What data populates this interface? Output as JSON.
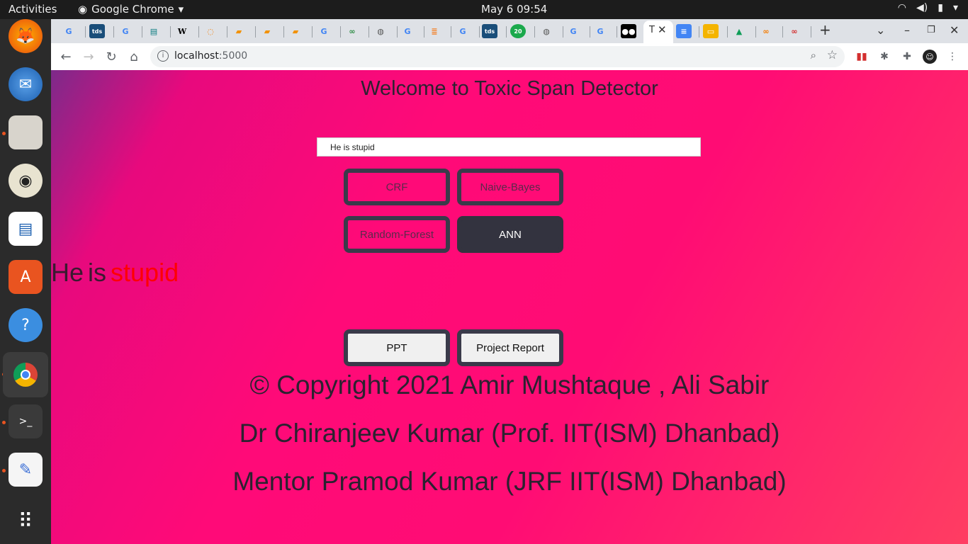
{
  "topbar": {
    "activities": "Activities",
    "app_name": "Google Chrome",
    "clock": "May 6  09:54"
  },
  "browser": {
    "url_host": "localhost",
    "url_port": ":5000",
    "active_tab_title": "T"
  },
  "page": {
    "title": "Welcome to Toxic Span Detector",
    "input_value": "He is stupid",
    "models": [
      "CRF",
      "Naive-Bayes",
      "Random-Forest",
      "ANN"
    ],
    "active_model": "ANN",
    "result_tokens": [
      {
        "text": "He",
        "toxic": false
      },
      {
        "text": "is",
        "toxic": false
      },
      {
        "text": "stupid",
        "toxic": true
      }
    ],
    "doc_buttons": [
      "PPT",
      "Project Report"
    ],
    "footer": [
      "© Copyright 2021 Amir Mushtaque , Ali Sabir",
      "Dr Chiranjeev Kumar (Prof. IIT(ISM) Dhanbad)",
      "Mentor Pramod Kumar (JRF IIT(ISM) Dhanbad)"
    ]
  },
  "colors": {
    "toxic": "#ff0000",
    "active_button": "#33333f"
  }
}
